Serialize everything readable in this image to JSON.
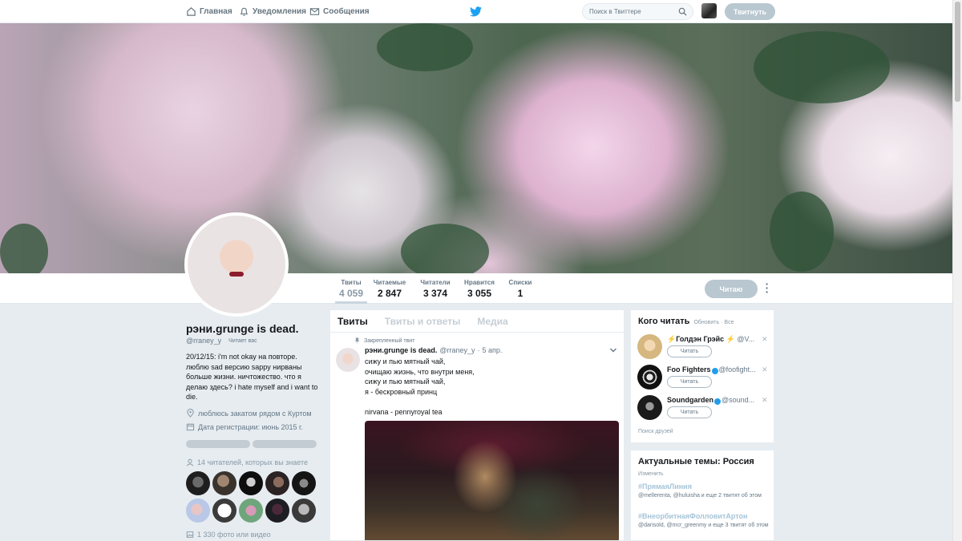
{
  "nav": {
    "home": "Главная",
    "notifications": "Уведомления",
    "messages": "Сообщения",
    "search_placeholder": "Поиск в Твиттере",
    "tweet_button": "Твитнуть",
    "icons": [
      "home-icon",
      "bell-icon",
      "envelope-icon",
      "twitter-bird-icon",
      "search-icon"
    ],
    "brand_color": "#1da1f2"
  },
  "stats": [
    {
      "label": "Твиты",
      "value": "4 059"
    },
    {
      "label": "Читаемые",
      "value": "2 847"
    },
    {
      "label": "Читатели",
      "value": "3 374"
    },
    {
      "label": "Нравится",
      "value": "3 055"
    },
    {
      "label": "Списки",
      "value": "1"
    }
  ],
  "follow_button": "Читаю",
  "profile": {
    "name": "рэни.grunge is dead.",
    "handle": "@rraney_y",
    "follows_you": "Читает вас",
    "bio": "20/12/15: i'm not okay на повторе.\nлюблю sad версию sappy нирваны\nбольше жизни. ничтожество. что я\nделаю здесь? i hate myself and i want to\ndie.",
    "location": "люблюсь закатом рядом с Куртом",
    "joined": "Дата регистрации: июнь 2015 г.",
    "followers_you_know": "14 читателей, которых вы знаете",
    "photos": "1 330 фото или видео"
  },
  "timeline": {
    "tabs": [
      "Твиты",
      "Твиты и ответы",
      "Медиа"
    ],
    "pinned_label": "Закрепленный твит",
    "tweet": {
      "name": "рэни.grunge is dead.",
      "handle": "@rraney_y",
      "sep": "·",
      "date": "5 апр.",
      "text": "сижу и пью мятный чай,\nочищаю жизнь, что внутри меня,\nсижу и пью мятный чай,\nя - бескровный принц\n\nnirvana - pennyroyal tea"
    }
  },
  "who_to_follow": {
    "title": "Кого читать",
    "refresh": "Обновить",
    "sep": "·",
    "all": "Все",
    "items": [
      {
        "name": "⚡Голдэн Грэйс ⚡",
        "handle": "@V...",
        "verified": false,
        "button": "Читать"
      },
      {
        "name": "Foo Fighters",
        "handle": "@foofight...",
        "verified": true,
        "button": "Читать"
      },
      {
        "name": "Soundgarden",
        "handle": "@sound...",
        "verified": true,
        "button": "Читать"
      }
    ],
    "find_friends": "Поиск друзей"
  },
  "trends": {
    "title": "Актуальные темы: Россия",
    "change": "Изменить",
    "items": [
      {
        "tag": "#ПрямаяЛиния",
        "desc": "@mellerenta, @huluisha и еще 2 твитят об этом"
      },
      {
        "tag": "#ВнеорбитнаяФолловитАртон",
        "desc": "@darisold, @mcr_greenmy и еще 3 твитят об этом"
      }
    ]
  }
}
